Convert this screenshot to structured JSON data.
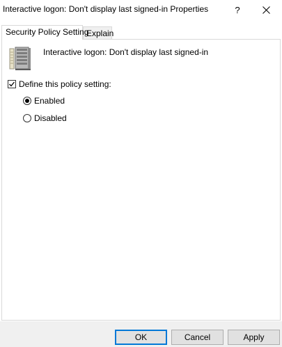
{
  "window": {
    "title": "Interactive logon: Don't display last signed-in Properties",
    "help_glyph": "?",
    "close_icon": "close-icon"
  },
  "tabs": [
    {
      "label": "Security Policy Setting",
      "active": true
    },
    {
      "label": "Explain",
      "active": false
    }
  ],
  "policy": {
    "icon": "server-policy-icon",
    "name": "Interactive logon: Don't display last signed-in"
  },
  "define_setting": {
    "label": "Define this policy setting:",
    "checked": true
  },
  "options": [
    {
      "label": "Enabled",
      "selected": true
    },
    {
      "label": "Disabled",
      "selected": false
    }
  ],
  "buttons": {
    "ok": "OK",
    "cancel": "Cancel",
    "apply": "Apply"
  },
  "colors": {
    "accent": "#0078d7",
    "footer_bg": "#f0f0f0",
    "button_bg": "#e1e1e1"
  }
}
